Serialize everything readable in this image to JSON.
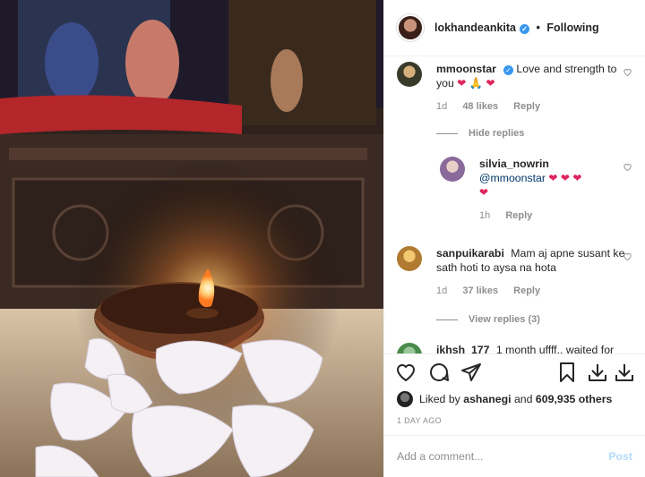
{
  "header": {
    "username": "lokhandeankita",
    "separator": "•",
    "follow_status": "Following"
  },
  "comments": [
    {
      "username": "mmoonstar",
      "verified": true,
      "text": "Love and strength to you",
      "emojis": [
        "❤",
        "🙏",
        "❤"
      ],
      "time": "1d",
      "likes": "48 likes",
      "reply": "Reply",
      "avatar_color": "#3a3a2a"
    },
    {
      "username": "silvia_nowrin",
      "text": "@mmoonstar",
      "emojis": [
        "❤",
        "❤",
        "❤",
        "❤"
      ],
      "time": "1h",
      "reply": "Reply",
      "avatar_color": "#8a6a9a"
    },
    {
      "username": "sanpuikarabi",
      "text": "Mam aj apne susant ke sath hoti to aysa na hota",
      "time": "1d",
      "likes": "37 likes",
      "reply": "Reply",
      "avatar_color": "#d8a440"
    },
    {
      "username": "ikhsh_177",
      "text": "1 month uffff.. waited for",
      "avatar_color": "#4a8a4a"
    }
  ],
  "hide_replies": "Hide replies",
  "view_replies": "View replies (3)",
  "actions": {
    "icons": [
      "heart-icon",
      "comment-icon",
      "share-icon",
      "bookmark-icon",
      "download-icon",
      "download-icon"
    ]
  },
  "likes": {
    "prefix": "Liked by",
    "user": "ashanegi",
    "conj": "and",
    "count": "609,935 others"
  },
  "time_ago": "1 DAY AGO",
  "add_comment": {
    "placeholder": "Add a comment...",
    "post_label": "Post"
  },
  "colors": {
    "accent": "#3897f0",
    "muted": "#8e8e8e",
    "post_disabled": "#b3dbff",
    "heart": "#e0245e"
  }
}
